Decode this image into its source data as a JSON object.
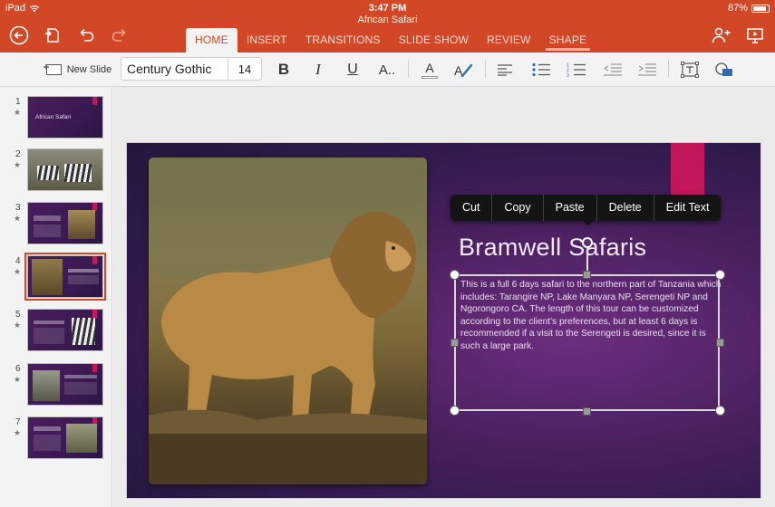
{
  "status_bar": {
    "device": "iPad",
    "time": "3:47 PM",
    "battery": "87%"
  },
  "document": {
    "title": "African Safari"
  },
  "ribbon": {
    "tabs": [
      {
        "label": "HOME",
        "active": true
      },
      {
        "label": "INSERT",
        "active": false
      },
      {
        "label": "TRANSITIONS",
        "active": false
      },
      {
        "label": "SLIDE SHOW",
        "active": false
      },
      {
        "label": "REVIEW",
        "active": false
      },
      {
        "label": "SHAPE",
        "active": false
      }
    ]
  },
  "toolbar": {
    "new_slide_label": "New Slide",
    "font_name": "Century Gothic",
    "font_size": "14",
    "bold_label": "B",
    "italic_label": "I",
    "underline_label": "U",
    "more_text_label": "A..",
    "font_color_label": "A",
    "accent_color": "#d24726"
  },
  "thumbnails": {
    "slides": [
      {
        "number": "1",
        "title": "African Safari"
      },
      {
        "number": "2",
        "title": ""
      },
      {
        "number": "3",
        "title": ""
      },
      {
        "number": "4",
        "title": "",
        "selected": true
      },
      {
        "number": "5",
        "title": ""
      },
      {
        "number": "6",
        "title": ""
      },
      {
        "number": "7",
        "title": ""
      }
    ]
  },
  "slide": {
    "title": "Bramwell Safaris",
    "body": "This is a full 6 days safari to the northern part of Tanzania which includes: Tarangire NP, Lake Manyara NP, Serengeti NP and Ngorongoro CA. The length of this tour can be customized according to the client's preferences, but at least 6 days is recommended if a visit to the Serengeti is desired, since it is such a large park.",
    "accent_color": "#c2185b"
  },
  "context_menu": {
    "items": [
      "Cut",
      "Copy",
      "Paste",
      "Delete",
      "Edit Text"
    ]
  }
}
